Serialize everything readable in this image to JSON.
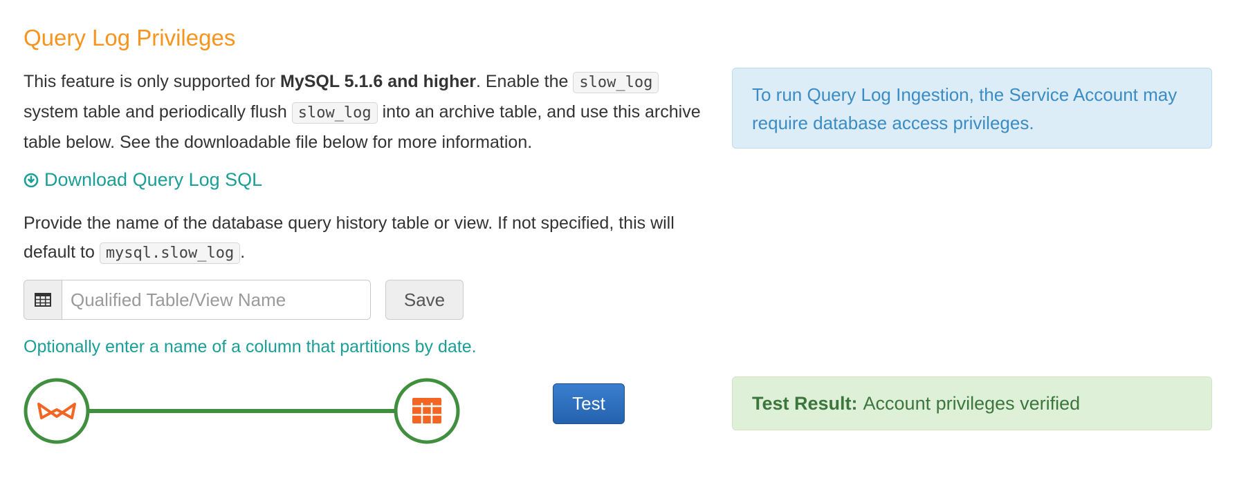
{
  "section": {
    "title": "Query Log Privileges"
  },
  "intro": {
    "text_before_bold": "This feature is only supported for ",
    "bold": "MySQL 5.1.6 and higher",
    "text_after_bold": ". Enable the ",
    "code1": "slow_log",
    "text_mid_1": " system table and periodically flush ",
    "code2": "slow_log",
    "text_mid_2": " into an archive table, and use this archive table below. See the downloadable file below for more information."
  },
  "download": {
    "label": "Download Query Log SQL",
    "icon": "download-circle-icon"
  },
  "history": {
    "text": "Provide the name of the database query history table or view. If not specified, this will default to ",
    "code": "mysql.slow_log",
    "suffix": "."
  },
  "table_input": {
    "placeholder": "Qualified Table/View Name",
    "value": "",
    "icon": "table-icon"
  },
  "save_button": {
    "label": "Save"
  },
  "partition_hint": {
    "text": "Optionally enter a name of a column that partitions by date."
  },
  "connection": {
    "source_icon": "bowtie-icon",
    "target_icon": "table-icon",
    "line_color": "#3f8f3f",
    "source_color": "#f26522",
    "target_color": "#f26522"
  },
  "test_button": {
    "label": "Test"
  },
  "info_alert": {
    "text": "To run Query Log Ingestion, the Service Account may require database access privileges."
  },
  "test_result": {
    "label": "Test Result:",
    "text": "Account privileges verified"
  },
  "colors": {
    "title": "#f7941d",
    "link": "#1a9e96",
    "info_bg": "#dcedf8",
    "info_text": "#3a8cc3",
    "success_bg": "#dff0d8",
    "success_text": "#3c763d",
    "primary_button": "#2462ad"
  }
}
